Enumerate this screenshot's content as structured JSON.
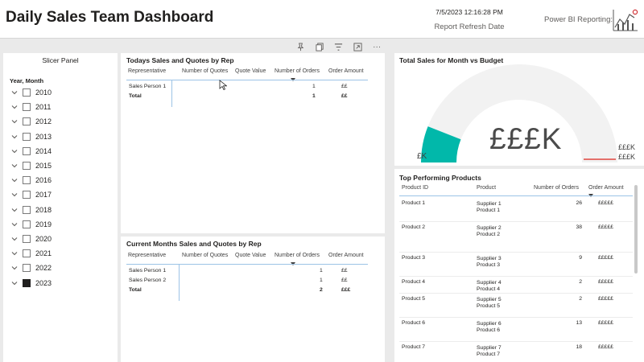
{
  "header": {
    "title": "Daily Sales Team Dashboard",
    "refresh_timestamp": "7/5/2023 12:16:28 PM",
    "refresh_label": "Report Refresh Date",
    "brand": "Power BI Reporting:"
  },
  "toolbar": {
    "icons": [
      "pin-icon",
      "copy-icon",
      "filter-icon",
      "focus-mode-icon",
      "more-options-icon"
    ],
    "more_label": "···"
  },
  "slicer": {
    "title": "Slicer Panel",
    "field": "Year, Month",
    "years": [
      {
        "label": "2010",
        "checked": false
      },
      {
        "label": "2011",
        "checked": false
      },
      {
        "label": "2012",
        "checked": false
      },
      {
        "label": "2013",
        "checked": false
      },
      {
        "label": "2014",
        "checked": false
      },
      {
        "label": "2015",
        "checked": false
      },
      {
        "label": "2016",
        "checked": false
      },
      {
        "label": "2017",
        "checked": false
      },
      {
        "label": "2018",
        "checked": false
      },
      {
        "label": "2019",
        "checked": false
      },
      {
        "label": "2020",
        "checked": false
      },
      {
        "label": "2021",
        "checked": false
      },
      {
        "label": "2022",
        "checked": false
      },
      {
        "label": "2023",
        "checked": true
      }
    ]
  },
  "today_table": {
    "title": "Todays Sales and Quotes by Rep",
    "columns": [
      "Representative",
      "Number of Quotes",
      "Quote Value",
      "Number of Orders",
      "Order Amount"
    ],
    "rows": [
      [
        "Sales Person 1",
        "",
        "",
        "1",
        "££"
      ]
    ],
    "total": [
      "Total",
      "",
      "",
      "1",
      "££"
    ]
  },
  "month_table": {
    "title": "Current Months Sales and Quotes by Rep",
    "columns": [
      "Representative",
      "Number of Quotes",
      "Quote Value",
      "Number of Orders",
      "Order Amount"
    ],
    "rows": [
      [
        "Sales Person 1",
        "",
        "",
        "1",
        "££"
      ],
      [
        "Sales Person 2",
        "",
        "",
        "1",
        "££"
      ]
    ],
    "total": [
      "Total",
      "",
      "",
      "2",
      "£££"
    ]
  },
  "gauge": {
    "title": "Total Sales for Month vs Budget",
    "value_label": "£££K",
    "min_label": "£K",
    "max_label": "£££K",
    "target_label": "£££K",
    "fill_fraction": 0.12,
    "fill_color": "#01b8aa",
    "track_color": "#f2f2f2",
    "target_color": "#e0453e"
  },
  "products": {
    "title": "Top Performing Products",
    "columns": [
      "Product ID",
      "Product",
      "Number of Orders",
      "Order Amount"
    ],
    "rows": [
      {
        "id": "Product  1",
        "supplier": "Supplier 1",
        "product": "Product 1",
        "orders": "26",
        "amount": "£££££"
      },
      {
        "id": "Product  2",
        "supplier": "Supplier 2",
        "product": "Product 2",
        "orders": "38",
        "amount": "£££££"
      },
      {
        "id": "Product  3",
        "supplier": "Supplier 3",
        "product": "Product 3",
        "orders": "9",
        "amount": "£££££"
      },
      {
        "id": "Product  4",
        "supplier": "Supplier 4",
        "product": "Product 4",
        "orders": "2",
        "amount": "£££££"
      },
      {
        "id": "Product  5",
        "supplier": "Supplier 5",
        "product": "Product 5",
        "orders": "2",
        "amount": "£££££"
      },
      {
        "id": "Product  6",
        "supplier": "Supplier 6",
        "product": "Product 6",
        "orders": "13",
        "amount": "£££££"
      },
      {
        "id": "Product  7",
        "supplier": "Supplier 7",
        "product": "Product 7",
        "orders": "18",
        "amount": "£££££"
      }
    ]
  },
  "colors": {
    "accent_line": "#9cc3e6",
    "gauge_fill": "#01b8aa",
    "logo_red": "#d13438"
  }
}
